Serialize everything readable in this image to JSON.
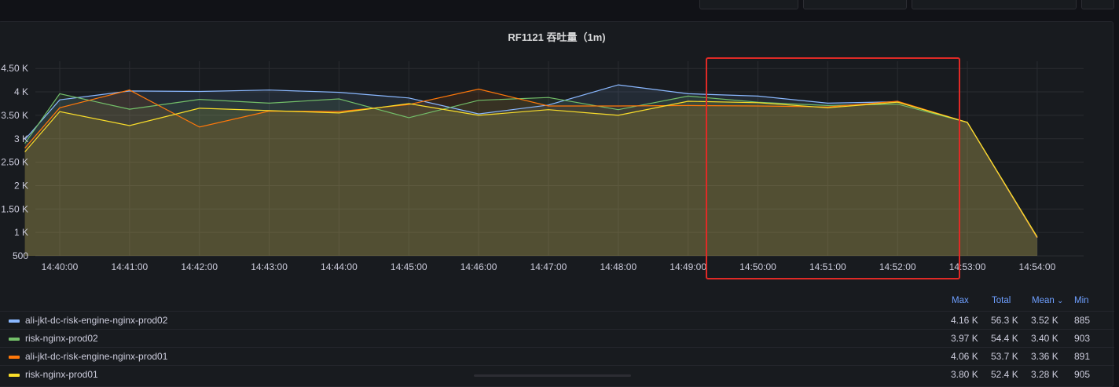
{
  "panel": {
    "title": "RF1121 吞吐量（1m)"
  },
  "chart_data": {
    "type": "area",
    "title": "RF1121 吞吐量（1m)",
    "x": [
      "14:39:30",
      "14:40:00",
      "14:41:00",
      "14:42:00",
      "14:43:00",
      "14:44:00",
      "14:45:00",
      "14:46:00",
      "14:47:00",
      "14:48:00",
      "14:49:00",
      "14:50:00",
      "14:51:00",
      "14:52:00",
      "14:53:00",
      "14:54:00"
    ],
    "x_ticks": [
      "14:40:00",
      "14:41:00",
      "14:42:00",
      "14:43:00",
      "14:44:00",
      "14:45:00",
      "14:46:00",
      "14:47:00",
      "14:48:00",
      "14:49:00",
      "14:50:00",
      "14:51:00",
      "14:52:00",
      "14:53:00",
      "14:54:00"
    ],
    "y_ticks": [
      "500",
      "1 K",
      "1.50 K",
      "2 K",
      "2.50 K",
      "3 K",
      "3.50 K",
      "4 K",
      "4.50 K"
    ],
    "y_tick_values": [
      500,
      1000,
      1500,
      2000,
      2500,
      3000,
      3500,
      4000,
      4500
    ],
    "ylim": [
      500,
      4600
    ],
    "grid": true,
    "legend_placement": "bottom",
    "series": [
      {
        "name": "ali-jkt-dc-risk-engine-nginx-prod02",
        "color": "#8ab8ff",
        "values": [
          2980,
          3830,
          4020,
          4010,
          4040,
          3990,
          3870,
          3530,
          3720,
          4150,
          3960,
          3910,
          3760,
          3790,
          3350,
          885
        ]
      },
      {
        "name": "risk-nginx-prod02",
        "color": "#73bf69",
        "values": [
          2900,
          3960,
          3630,
          3840,
          3760,
          3850,
          3450,
          3820,
          3880,
          3620,
          3910,
          3780,
          3710,
          3740,
          3350,
          903
        ]
      },
      {
        "name": "ali-jkt-dc-risk-engine-nginx-prod01",
        "color": "#ff780a",
        "values": [
          2800,
          3660,
          4040,
          3250,
          3590,
          3580,
          3730,
          4060,
          3700,
          3700,
          3710,
          3700,
          3680,
          3800,
          3350,
          891
        ]
      },
      {
        "name": "risk-nginx-prod01",
        "color": "#fade2a",
        "values": [
          2720,
          3580,
          3280,
          3650,
          3600,
          3550,
          3750,
          3500,
          3620,
          3500,
          3800,
          3770,
          3660,
          3780,
          3350,
          905
        ]
      }
    ]
  },
  "legend": {
    "headers": {
      "max": "Max",
      "total": "Total",
      "mean": "Mean",
      "mean_sort_icon": "⌄",
      "min": "Min"
    },
    "rows": [
      {
        "name": "ali-jkt-dc-risk-engine-nginx-prod02",
        "color": "#8ab8ff",
        "max": "4.16 K",
        "total": "56.3 K",
        "mean": "3.52 K",
        "min": "885"
      },
      {
        "name": "risk-nginx-prod02",
        "color": "#73bf69",
        "max": "3.97 K",
        "total": "54.4 K",
        "mean": "3.40 K",
        "min": "903"
      },
      {
        "name": "ali-jkt-dc-risk-engine-nginx-prod01",
        "color": "#ff780a",
        "max": "4.06 K",
        "total": "53.7 K",
        "mean": "3.36 K",
        "min": "891"
      },
      {
        "name": "risk-nginx-prod01",
        "color": "#fade2a",
        "max": "3.80 K",
        "total": "52.4 K",
        "mean": "3.28 K",
        "min": "905"
      }
    ]
  },
  "annotation": {
    "color": "#e02a26"
  }
}
